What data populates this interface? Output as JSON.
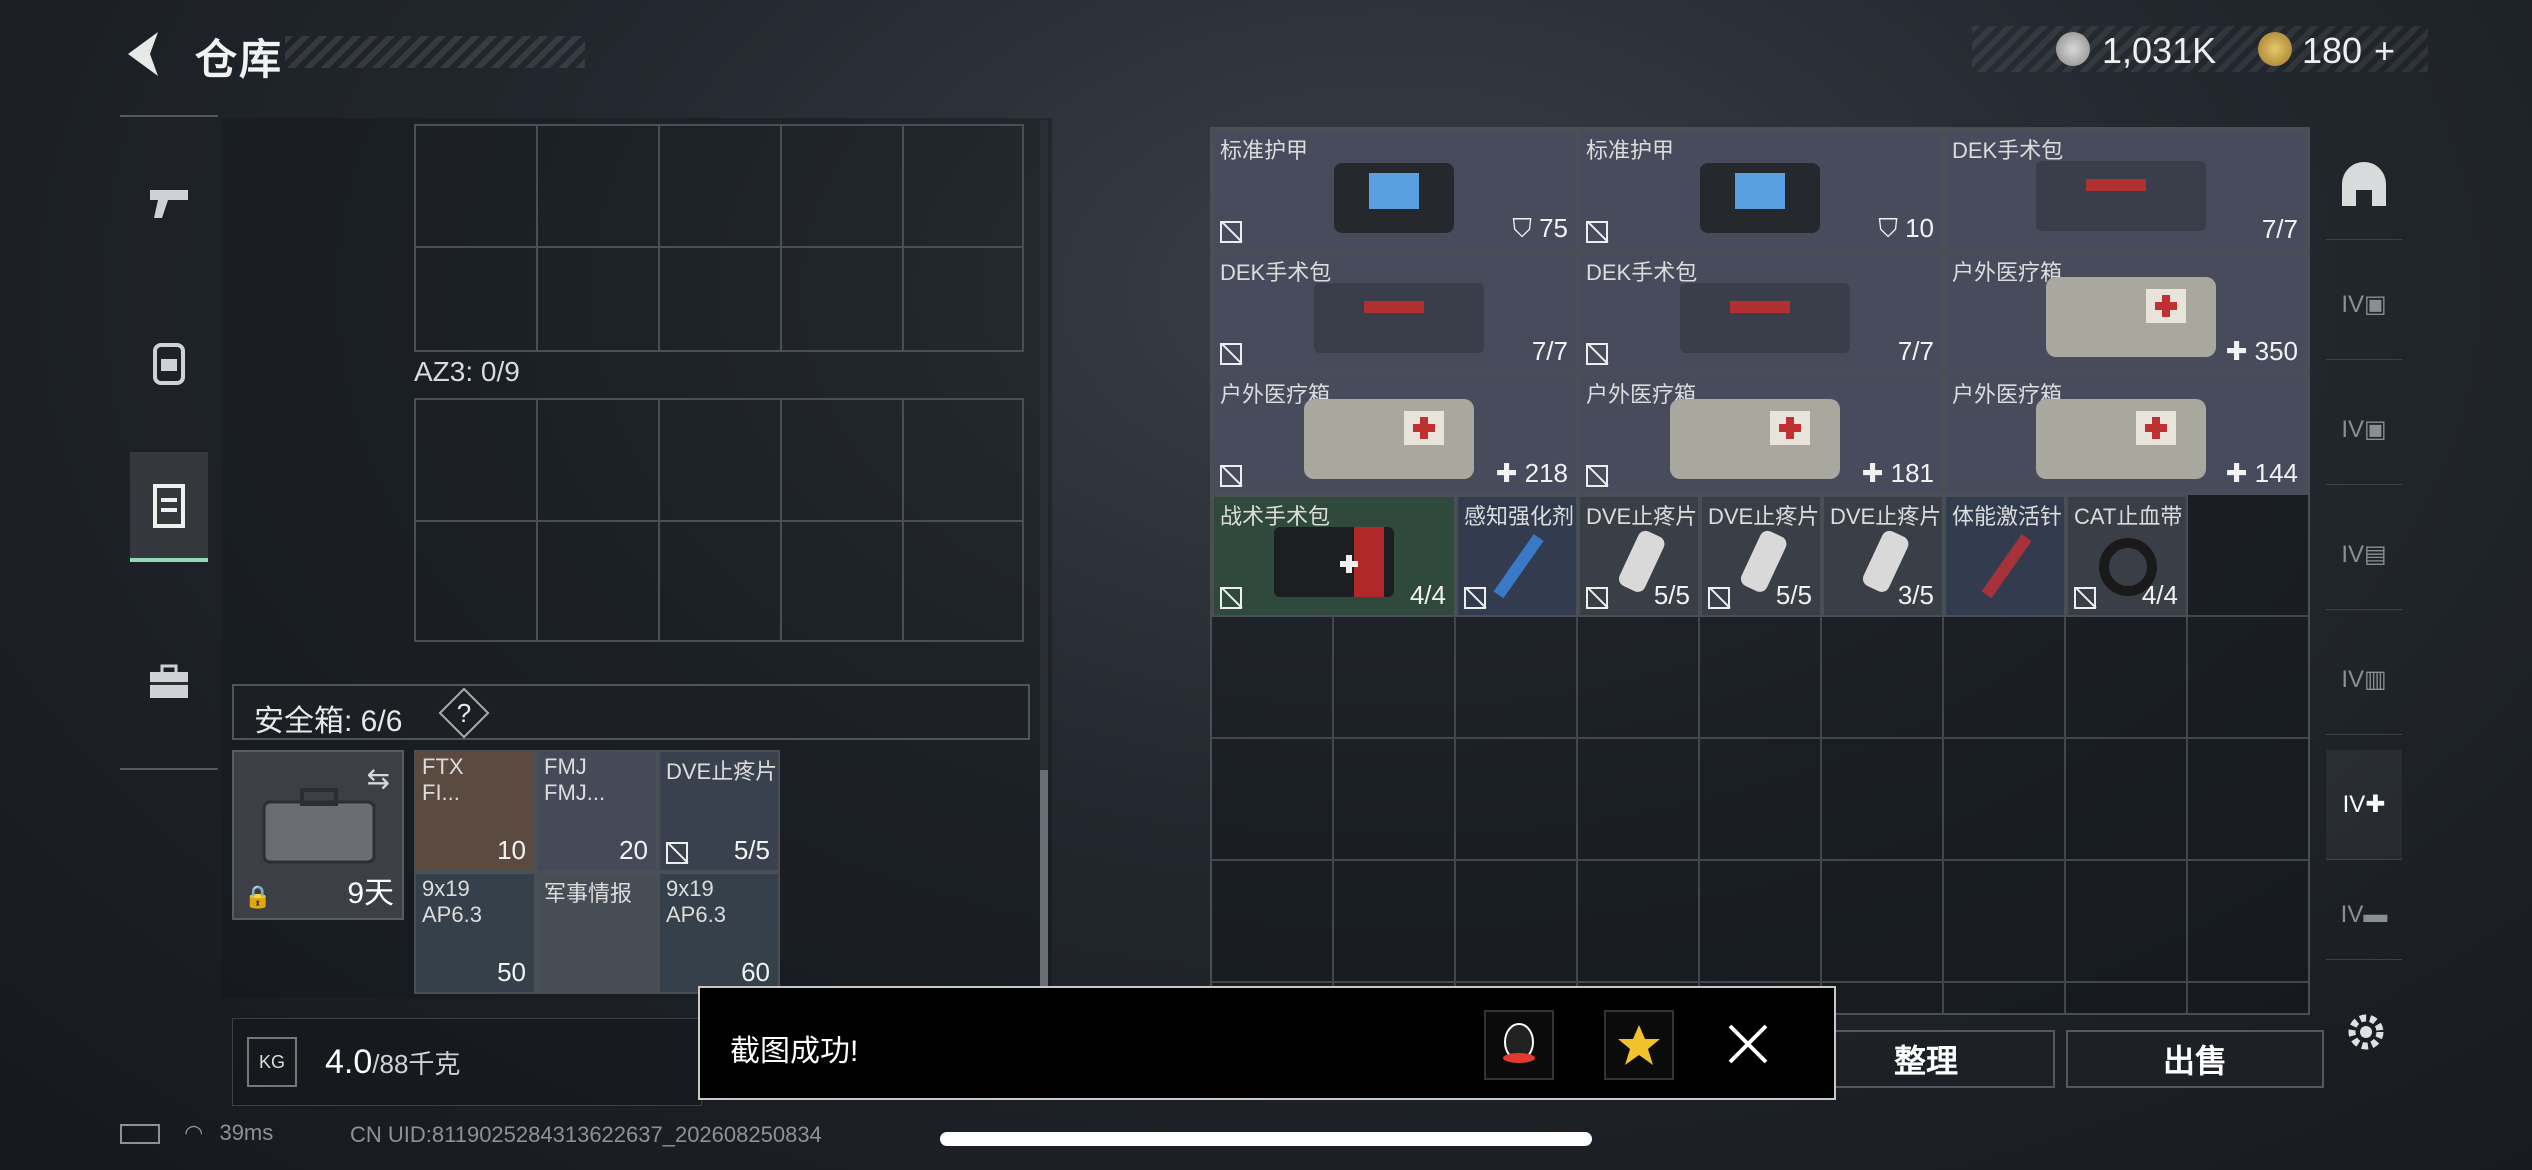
{
  "header": {
    "title": "仓库",
    "currency_1": "1,031K",
    "currency_2": "180",
    "currency_2_suffix": "+"
  },
  "left_panel": {
    "az3_label": "AZ3: 0/9",
    "safebox_label": "安全箱: 6/6",
    "safebox_help": "?",
    "case_time": "9天",
    "safe_items": [
      {
        "name": "FTX\nFI...",
        "count": "10"
      },
      {
        "name": "FMJ\nFMJ...",
        "count": "20"
      },
      {
        "name": "DVE止疼片",
        "count": "5/5"
      },
      {
        "name": "9x19\nAP6.3",
        "count": "50"
      },
      {
        "name": "军事情报",
        "count": ""
      },
      {
        "name": "9x19\nAP6.3",
        "count": "60"
      }
    ],
    "weight_value": "4.0",
    "weight_unit": "/88千克",
    "weight_icon": "KG"
  },
  "right_items": [
    {
      "name": "标准护甲",
      "count": "75",
      "badge": "shield"
    },
    {
      "name": "标准护甲",
      "count": "10",
      "badge": "shield"
    },
    {
      "name": "DEK手术包",
      "count": "7/7",
      "badge": ""
    },
    {
      "name": "DEK手术包",
      "count": "7/7",
      "badge": ""
    },
    {
      "name": "DEK手术包",
      "count": "7/7",
      "badge": ""
    },
    {
      "name": "户外医疗箱",
      "count": "350",
      "badge": "plus"
    },
    {
      "name": "户外医疗箱",
      "count": "218",
      "badge": "plus"
    },
    {
      "name": "户外医疗箱",
      "count": "181",
      "badge": "plus"
    },
    {
      "name": "户外医疗箱",
      "count": "144",
      "badge": "plus"
    },
    {
      "name": "战术手术包",
      "count": "4/4",
      "badge": ""
    },
    {
      "name": "感知强化剂",
      "count": "",
      "badge": ""
    },
    {
      "name": "DVE止疼片",
      "count": "5/5",
      "badge": ""
    },
    {
      "name": "DVE止疼片",
      "count": "5/5",
      "badge": ""
    },
    {
      "name": "DVE止疼片",
      "count": "3/5",
      "badge": ""
    },
    {
      "name": "体能激活针",
      "count": "",
      "badge": ""
    },
    {
      "name": "CAT止血带",
      "count": "4/4",
      "badge": ""
    }
  ],
  "side_categories": [
    "IV",
    "IV",
    "IV",
    "IV",
    "IV",
    "IV"
  ],
  "buttons": {
    "sort": "整理",
    "sell": "出售"
  },
  "toast": {
    "text": "截图成功!"
  },
  "status": {
    "ping": "39ms",
    "uid": "CN UID:8119025284313622637_202608250834"
  }
}
